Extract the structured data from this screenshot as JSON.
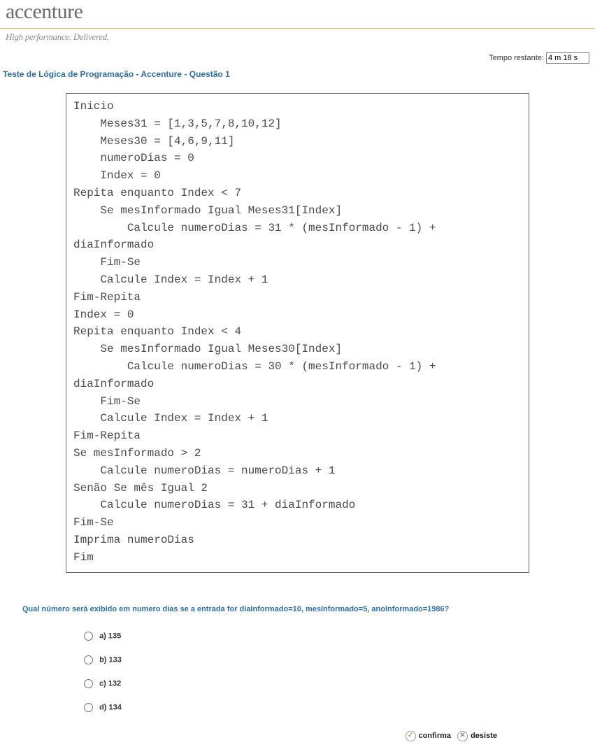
{
  "header": {
    "logo": "accenture",
    "tagline": "High performance. Delivered."
  },
  "timer": {
    "label": "Tempo restante:",
    "value": "4 m 18 s"
  },
  "test_title": "Teste de Lógica de Programação - Accenture - Questão 1",
  "code": "Inicio\n    Meses31 = [1,3,5,7,8,10,12]\n    Meses30 = [4,6,9,11]\n    numeroDias = 0\n    Index = 0\nRepita enquanto Index < 7\n    Se mesInformado Igual Meses31[Index]\n        Calcule numeroDias = 31 * (mesInformado - 1) +\ndiaInformado\n    Fim-Se\n    Calcule Index = Index + 1\nFim-Repita\nIndex = 0\nRepita enquanto Index < 4\n    Se mesInformado Igual Meses30[Index]\n        Calcule numeroDias = 30 * (mesInformado - 1) +\ndiaInformado\n    Fim-Se\n    Calcule Index = Index + 1\nFim-Repita\nSe mesInformado > 2\n    Calcule numeroDias = numeroDias + 1\nSenão Se mês Igual 2\n    Calcule numeroDias = 31 + diaInformado\nFim-Se\nImprima numeroDias\nFim",
  "question": "Qual número será exibido em numero dias se a entrada for diaInformado=10, mesInformado=5, anoInformado=1986?",
  "options": [
    {
      "label": "a) 135"
    },
    {
      "label": "b) 133"
    },
    {
      "label": "c) 132"
    },
    {
      "label": "d) 134"
    }
  ],
  "actions": {
    "confirm": "confirma",
    "giveup": "desiste"
  }
}
